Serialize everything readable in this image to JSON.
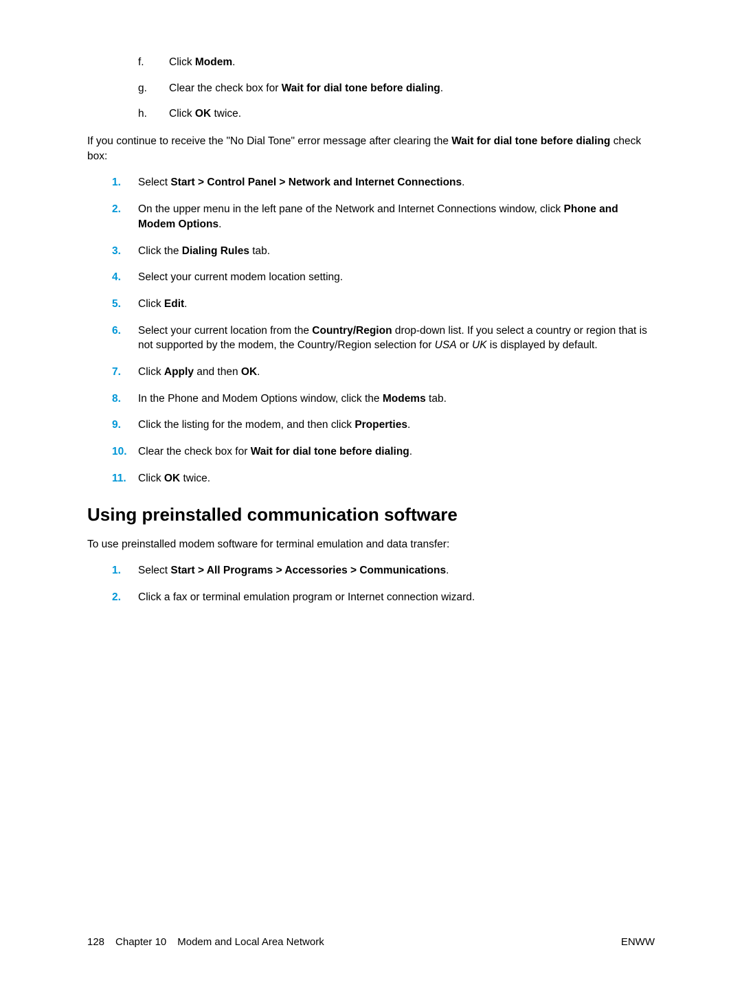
{
  "sublist": [
    {
      "marker": "f.",
      "html": "Click <b>Modem</b>."
    },
    {
      "marker": "g.",
      "html": "Clear the check box for <b>Wait for dial tone before dialing</b>."
    },
    {
      "marker": "h.",
      "html": "Click <b>OK</b> twice."
    }
  ],
  "para1_html": "If you continue to receive the \"No Dial Tone\" error message after clearing the <b>Wait for dial tone before dialing</b> check box:",
  "mainlist1": [
    {
      "marker": "1.",
      "html": "Select <b>Start > Control Panel > Network and Internet Connections</b>."
    },
    {
      "marker": "2.",
      "html": "On the upper menu in the left pane of the Network and Internet Connections window, click <b>Phone and Modem Options</b>."
    },
    {
      "marker": "3.",
      "html": "Click the <b>Dialing Rules</b> tab."
    },
    {
      "marker": "4.",
      "html": "Select your current modem location setting."
    },
    {
      "marker": "5.",
      "html": "Click <b>Edit</b>."
    },
    {
      "marker": "6.",
      "html": "Select your current location from the <b>Country/Region</b> drop-down list. If you select a country or region that is not supported by the modem, the Country/Region selection for <i>USA</i> or <i>UK</i> is displayed by default."
    },
    {
      "marker": "7.",
      "html": "Click <b>Apply</b> and then <b>OK</b>."
    },
    {
      "marker": "8.",
      "html": "In the Phone and Modem Options window, click the <b>Modems</b> tab."
    },
    {
      "marker": "9.",
      "html": "Click the listing for the modem, and then click <b>Properties</b>."
    },
    {
      "marker": "10.",
      "html": "Clear the check box for <b>Wait for dial tone before dialing</b>."
    },
    {
      "marker": "11.",
      "html": "Click <b>OK</b> twice."
    }
  ],
  "heading": "Using preinstalled communication software",
  "para2": "To use preinstalled modem software for terminal emulation and data transfer:",
  "mainlist2": [
    {
      "marker": "1.",
      "html": "Select <b>Start > All Programs > Accessories > Communications</b>."
    },
    {
      "marker": "2.",
      "html": "Click a fax or terminal emulation program or Internet connection wizard."
    }
  ],
  "footer": {
    "page": "128",
    "chapter": "Chapter 10",
    "title": "Modem and Local Area Network",
    "right": "ENWW"
  }
}
